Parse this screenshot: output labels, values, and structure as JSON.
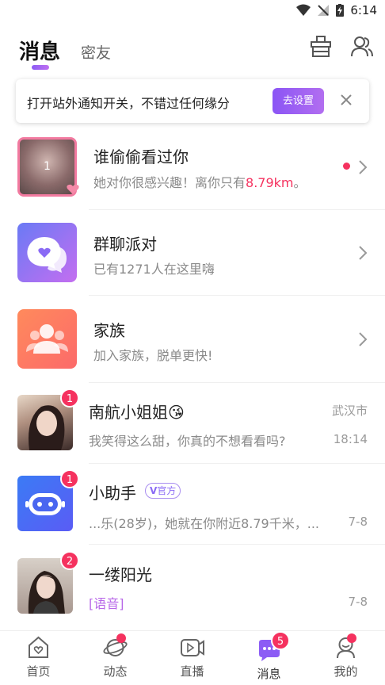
{
  "status": {
    "time": "6:14"
  },
  "header": {
    "tabs": [
      {
        "label": "消息",
        "active": true
      },
      {
        "label": "密友",
        "active": false
      }
    ],
    "icons": [
      "shop-icon",
      "contacts-icon"
    ]
  },
  "notice": {
    "text": "打开站外通知开关，不错过任何缘分",
    "button": "去设置"
  },
  "who_viewed": {
    "title": "谁偷偷看过你",
    "sub_prefix": "她对你很感兴趣！离你只有",
    "distance": "8.79km",
    "sub_suffix": "。",
    "avatar_count": "1"
  },
  "group_party": {
    "title": "群聊派对",
    "sub": "已有1271人在这里嗨"
  },
  "family": {
    "title": "家族",
    "sub": "加入家族，脱单更快!"
  },
  "chats": [
    {
      "name": "南航小姐姐",
      "emoji": "😘",
      "location": "武汉市",
      "message": "我笑得这么甜，你真的不想看看吗?",
      "time": "18:14",
      "unread": "1"
    },
    {
      "name": "小助手",
      "tag": "官方",
      "message": "...乐(28岁)，她就在你附近8.79千米，...",
      "time": "7-8",
      "unread": "1"
    },
    {
      "name": "一缕阳光",
      "message": "[语音]",
      "time": "7-8",
      "unread": "2"
    }
  ],
  "tabbar": [
    {
      "label": "首页",
      "icon": "home-icon",
      "dot": false
    },
    {
      "label": "动态",
      "icon": "planet-icon",
      "dot": true
    },
    {
      "label": "直播",
      "icon": "live-icon",
      "dot": false
    },
    {
      "label": "消息",
      "icon": "message-icon",
      "badge": "5"
    },
    {
      "label": "我的",
      "icon": "profile-icon",
      "dot": true
    }
  ],
  "colors": {
    "accent": "#8c5cf5",
    "badge": "#f5325f",
    "distance": "#f5325f",
    "voice": "#b868e8"
  }
}
